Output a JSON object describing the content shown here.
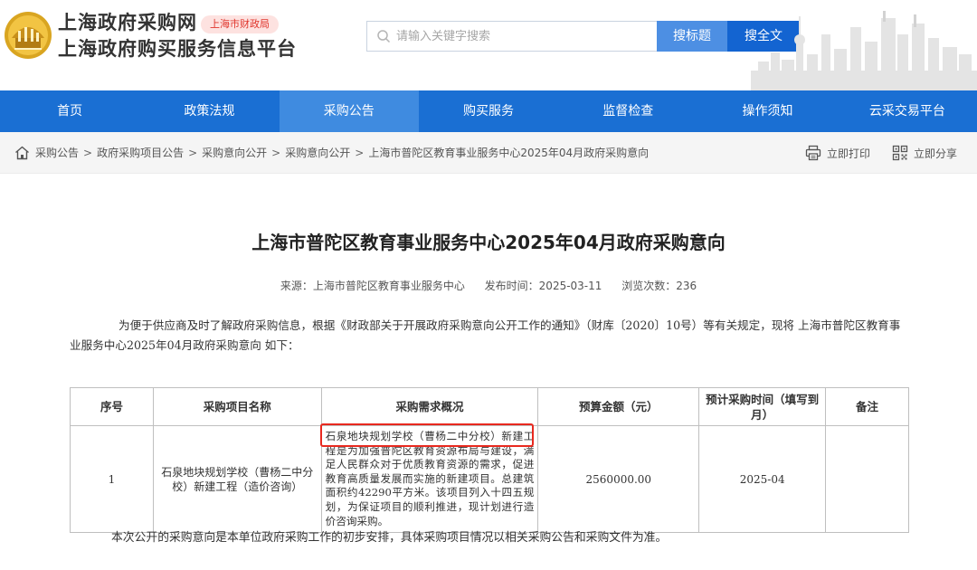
{
  "header": {
    "site_title": "上海政府采购网",
    "site_subtitle": "上海政府购买服务信息平台",
    "badge": "上海市财政局",
    "search_placeholder": "请输入关键字搜索",
    "search_title_button": "搜标题",
    "search_full_button": "搜全文",
    "logo_icon": "shanghai-gov-emblem",
    "skyline_icon": "city-skyline"
  },
  "nav": {
    "items": [
      "首页",
      "政策法规",
      "采购公告",
      "购买服务",
      "监督检查",
      "操作须知",
      "云采交易平台"
    ],
    "active_index": 2
  },
  "breadcrumb": {
    "items": [
      "采购公告",
      "政府采购项目公告",
      "采购意向公开",
      "采购意向公开",
      "上海市普陀区教育事业服务中心2025年04月政府采购意向"
    ],
    "separator": ">",
    "print_label": "立即打印",
    "share_label": "立即分享"
  },
  "article": {
    "title": "上海市普陀区教育事业服务中心2025年04月政府采购意向",
    "source": "来源：上海市普陀区教育事业服务中心",
    "publish_time": "发布时间：2025-03-11",
    "views": "浏览次数：236",
    "intro": "为便于供应商及时了解政府采购信息，根据《财政部关于开展政府采购意向公开工作的通知》（财库〔2020〕10号）等有关规定，现将 上海市普陀区教育事业服务中心2025年04月政府采购意向 如下：",
    "footer_note": "本次公开的采购意向是本单位政府采购工作的初步安排，具体采购项目情况以相关采购公告和采购文件为准。"
  },
  "table": {
    "headers": [
      "序号",
      "采购项目名称",
      "采购需求概况",
      "预算金额（元）",
      "预计采购时间（填写到月）",
      "备注"
    ],
    "rows": [
      {
        "index": "1",
        "name": "石泉地块规划学校（曹杨二中分校）新建工程（造价咨询）",
        "desc_highlight": "石泉地块规划学校（曹杨二中分校）",
        "desc_rest": "新建工程是为加强普陀区教育资源布局与建设，满足人民群众对于优质教育资源的需求，促进教育高质量发展而实施的新建项目。总建筑面积约42290平方米。该项目列入十四五规划，为保证项目的顺利推进，现计划进行造价咨询采购。",
        "budget": "2560000.00",
        "time": "2025-04",
        "remark": ""
      }
    ]
  },
  "colors": {
    "nav_bg": "#1a6fd3",
    "nav_active": "#3f8be0",
    "search_title_btn": "#4d8fe3",
    "search_full_btn": "#1364d1",
    "highlight_border": "#e8291f",
    "badge_text": "#e0352c"
  }
}
